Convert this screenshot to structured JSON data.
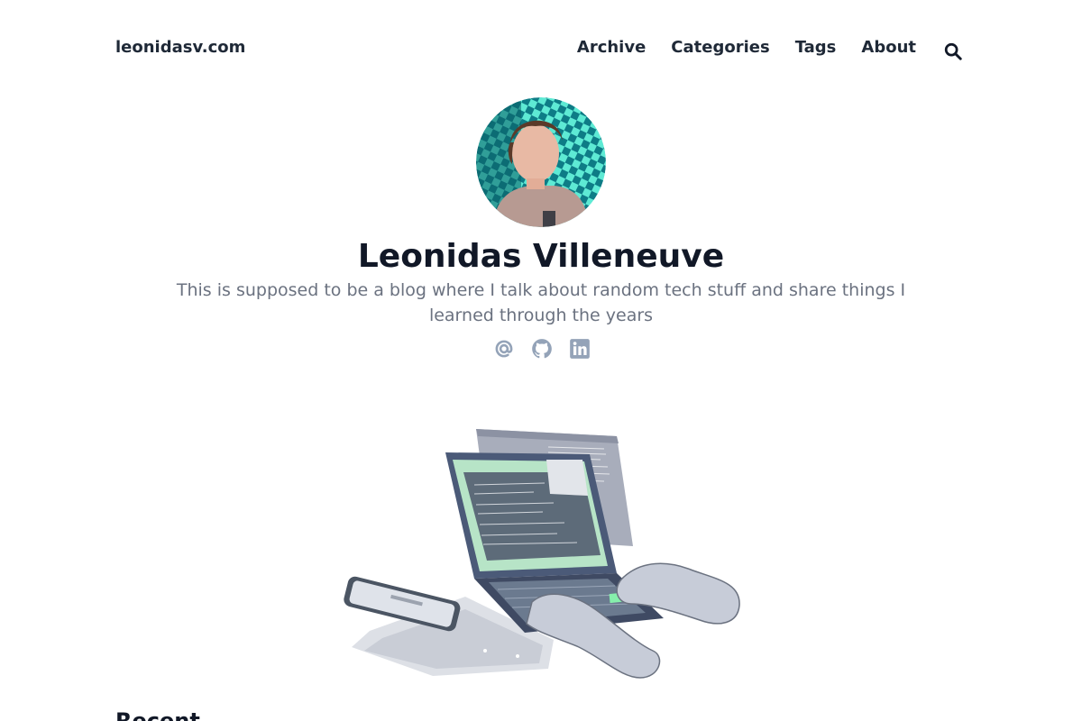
{
  "header": {
    "site_title": "leonidasv.com",
    "nav": [
      "Archive",
      "Categories",
      "Tags",
      "About"
    ],
    "search_icon": "search-icon"
  },
  "profile": {
    "name": "Leonidas Villeneuve",
    "bio": "This is supposed to be a blog where I talk about random tech stuff and share things I learned through the years",
    "social_icons": [
      "at-icon",
      "github-icon",
      "linkedin-icon"
    ]
  },
  "main": {
    "section_title": "Recent"
  },
  "colors": {
    "text_dark": "#111827",
    "text_muted": "#6b7280",
    "icon_muted": "#94a3b8",
    "avatar_teal": "#14b8a6"
  }
}
